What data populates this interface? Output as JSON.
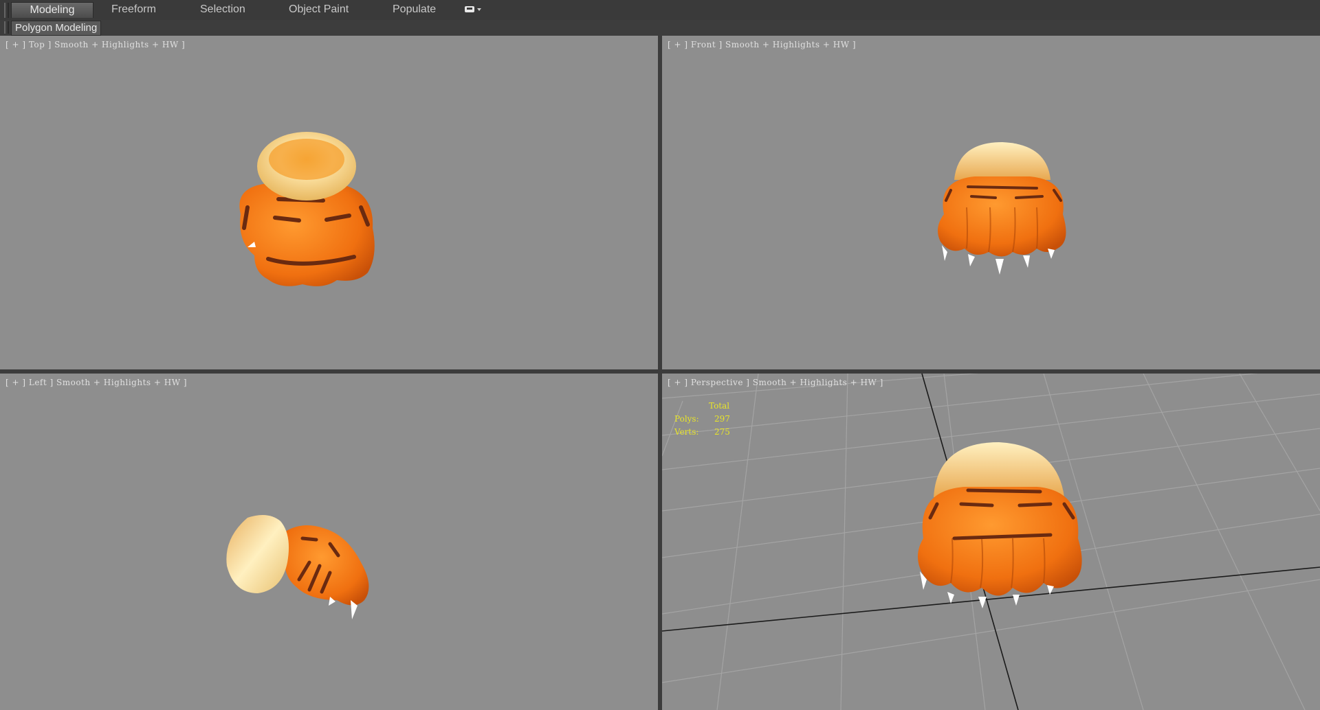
{
  "ribbon": {
    "tabs": [
      {
        "label": "Modeling",
        "active": true
      },
      {
        "label": "Freeform",
        "active": false
      },
      {
        "label": "Selection",
        "active": false
      },
      {
        "label": "Object Paint",
        "active": false
      },
      {
        "label": "Populate",
        "active": false
      }
    ],
    "dropdown_icon": "display-dropdown-icon",
    "panel_label": "Polygon Modeling"
  },
  "viewports": {
    "top": {
      "label": "[ + ] Top ] Smooth + Highlights + HW ]"
    },
    "front": {
      "label": "[ + ] Front ] Smooth + Highlights + HW ]"
    },
    "left": {
      "label": "[ + ] Left ] Smooth + Highlights + HW ]"
    },
    "perspective": {
      "label": "[ + ] Perspective ] Smooth + Highlights + HW ]",
      "stats": {
        "title": "Total",
        "polys_label": "Polys:",
        "polys_value": "297",
        "verts_label": "Verts:",
        "verts_value": "275"
      }
    }
  },
  "colors": {
    "viewport_bg": "#8e8e8e",
    "paw_orange": "#f07818",
    "fur_cream": "#f6d98e",
    "stats_yellow": "#e8e42a"
  }
}
